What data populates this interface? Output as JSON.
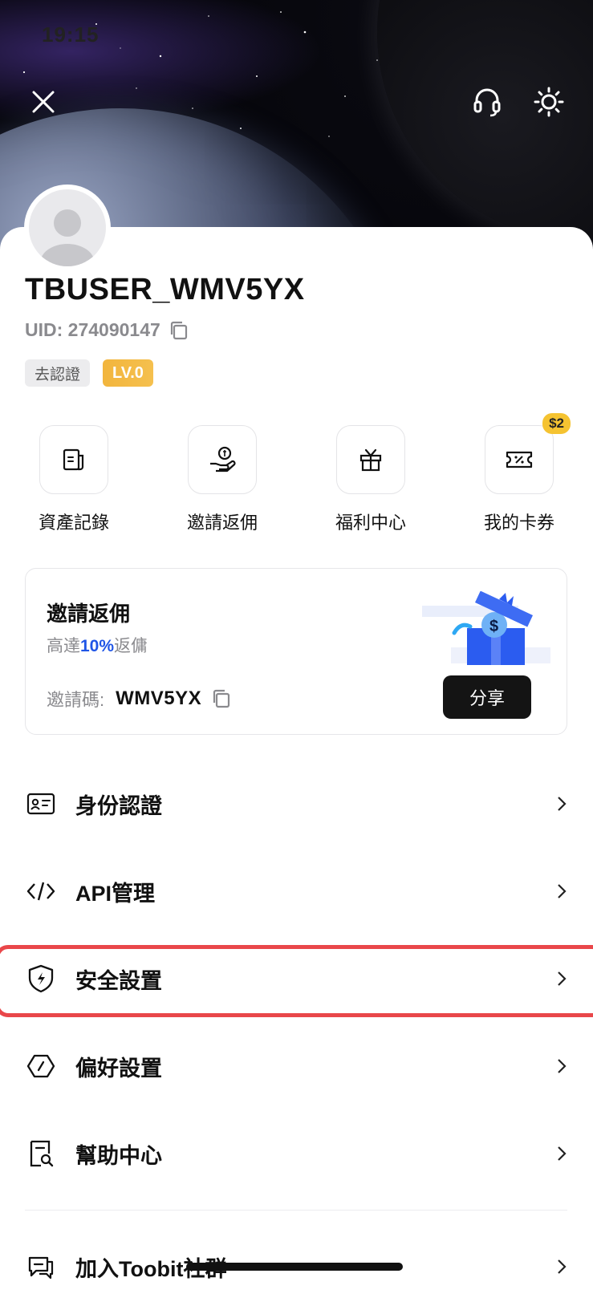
{
  "status_bar": {
    "time": "19:15"
  },
  "header": {
    "close_icon": "close-icon",
    "support_icon": "headset-icon",
    "theme_icon": "sun-icon"
  },
  "profile": {
    "username": "TBUSER_WMV5YX",
    "uid_label": "UID: 274090147",
    "verify_badge": "去認證",
    "level_badge": "LV.0"
  },
  "quick_actions": [
    {
      "label": "資產記錄",
      "icon": "asset-record-icon"
    },
    {
      "label": "邀請返佣",
      "icon": "invite-rebate-icon"
    },
    {
      "label": "福利中心",
      "icon": "gift-icon"
    },
    {
      "label": "我的卡券",
      "icon": "coupon-icon",
      "badge": "$2"
    }
  ],
  "invite_card": {
    "title": "邀請返佣",
    "subtitle_prefix": "高達",
    "subtitle_highlight": "10%",
    "subtitle_suffix": "返傭",
    "code_label": "邀請碼:",
    "code": "WMV5YX",
    "share_button": "分享"
  },
  "menu": [
    {
      "label": "身份認證",
      "icon": "id-card-icon"
    },
    {
      "label": "API管理",
      "icon": "code-icon"
    },
    {
      "label": "安全設置",
      "icon": "shield-icon",
      "highlighted": true
    },
    {
      "label": "偏好設置",
      "icon": "preferences-icon"
    },
    {
      "label": "幫助中心",
      "icon": "help-doc-icon"
    },
    {
      "label": "加入Toobit社群",
      "icon": "community-chat-icon"
    }
  ],
  "colors": {
    "accent_blue": "#1f55e6",
    "level_gold": "#f2b53d",
    "highlight_red": "#e9474a",
    "share_button_bg": "#141414"
  }
}
